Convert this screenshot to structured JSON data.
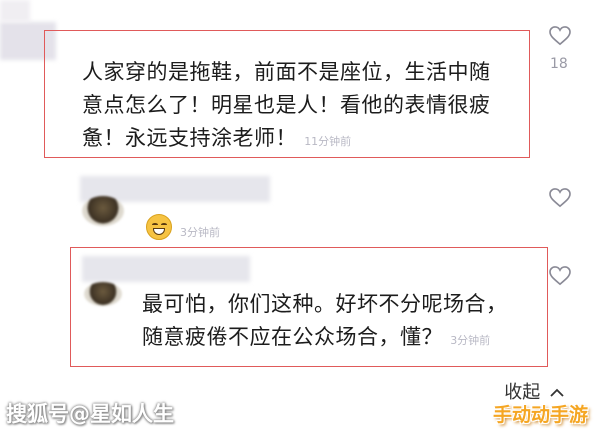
{
  "comments": [
    {
      "text_line1": "人家穿的是拖鞋，前面不是座位，生活中随",
      "text_line2": "意点怎么了！明星也是人！看他的表情很疲",
      "text_line3": "惫！永远支持涂老师！",
      "time": "11分钟前",
      "likes": "18"
    },
    {
      "time": "3分钟前"
    },
    {
      "text_line1": "最可怕，你们这种。好坏不分呢场合，",
      "text_line2": "随意疲倦不应在公众场合，懂？",
      "time": "3分钟前"
    }
  ],
  "collapse_label": "收起",
  "watermark_left": "搜狐号@星如人生",
  "watermark_right": "手动动手游",
  "colors": {
    "highlight_border": "#e05a5a",
    "accent_orange": "#f5a623"
  }
}
